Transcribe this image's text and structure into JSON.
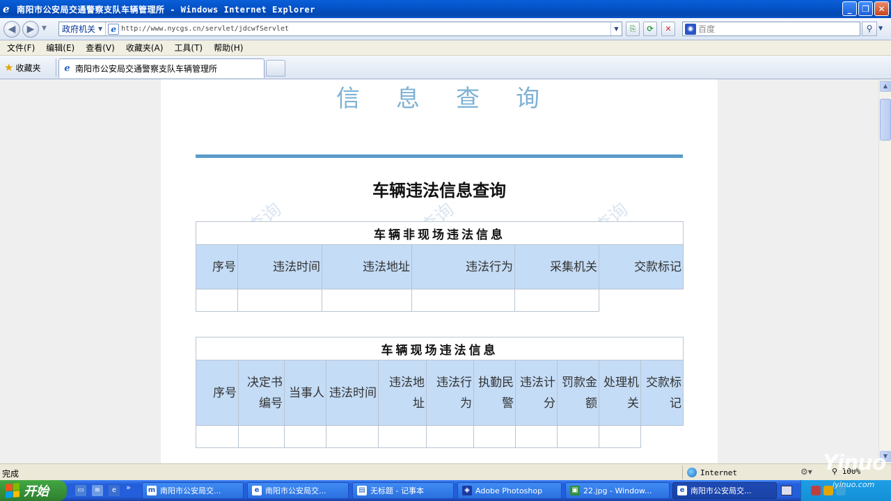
{
  "window": {
    "title": "南阳市公安局交通警察支队车辆管理所 - Windows Internet Explorer",
    "buttons": {
      "minimize": "_",
      "maximize": "❐",
      "close": "✕"
    }
  },
  "address_bar": {
    "zone_label": "政府机关",
    "url": "http://www.nycgs.cn/servlet/jdcwfServlet",
    "search_placeholder": "百度"
  },
  "menu": [
    "文件(F)",
    "编辑(E)",
    "查看(V)",
    "收藏夹(A)",
    "工具(T)",
    "帮助(H)"
  ],
  "tabs": {
    "favorites_label": "收藏夹",
    "active_tab": "南阳市公安局交通警察支队车辆管理所"
  },
  "page": {
    "banner": "信息查询",
    "title": "车辆违法信息查询",
    "watermark": "查询",
    "offsite_table": {
      "caption": "车辆非现场违法信息",
      "headers": [
        "序号",
        "违法时间",
        "违法地址",
        "违法行为",
        "采集机关",
        "交款标记"
      ]
    },
    "onsite_table": {
      "caption": "车辆现场违法信息",
      "headers": [
        "序号",
        "决定书编号",
        "当事人",
        "违法时间",
        "违法地址",
        "违法行为",
        "执勤民警",
        "违法计分",
        "罚款金额",
        "处理机关",
        "交款标记"
      ]
    }
  },
  "status_bar": {
    "status": "完成",
    "zone": "Internet",
    "zoom": "100%"
  },
  "taskbar": {
    "start_label": "开始",
    "tasks": [
      "南阳市公安局交...",
      "南阳市公安局交...",
      "无标题 - 记事本",
      "Adobe Photoshop",
      "22.jpg - Window...",
      "南阳市公安局交..."
    ]
  },
  "watermark_logo": {
    "brand": "Yinuo",
    "site": "iyinuo.com"
  },
  "colors": {
    "header_bg": "#c4dcf6",
    "rule": "#5b9cc9",
    "banner": "#7fb2d4"
  }
}
